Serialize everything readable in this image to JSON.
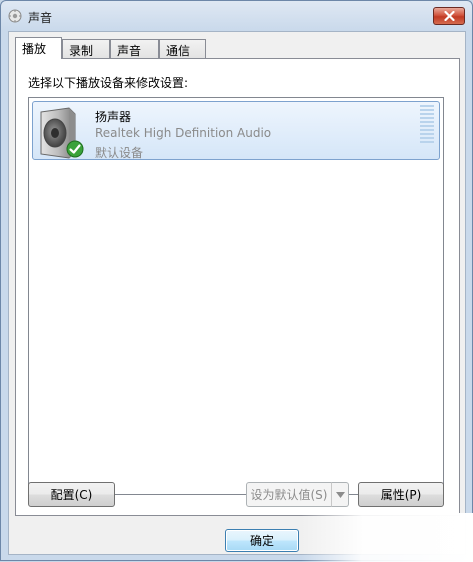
{
  "window": {
    "title": "声音"
  },
  "tabs": [
    {
      "label": "播放",
      "active": true
    },
    {
      "label": "录制",
      "active": false
    },
    {
      "label": "声音",
      "active": false
    },
    {
      "label": "通信",
      "active": false
    }
  ],
  "playback": {
    "instruction": "选择以下播放设备来修改设置:",
    "devices": [
      {
        "name": "扬声器",
        "description": "Realtek High Definition Audio",
        "status": "默认设备",
        "icon": "speaker-icon",
        "badge": "green-checkmark-icon"
      }
    ]
  },
  "buttons": {
    "configure": "配置(C)",
    "set_default": "设为默认值(S)",
    "properties": "属性(P)",
    "ok": "确定"
  },
  "colors": {
    "selection_border": "#7da2ce",
    "selection_fill": "#d5e6f8",
    "close_button": "#c13a24",
    "check_green": "#3aa23a"
  }
}
